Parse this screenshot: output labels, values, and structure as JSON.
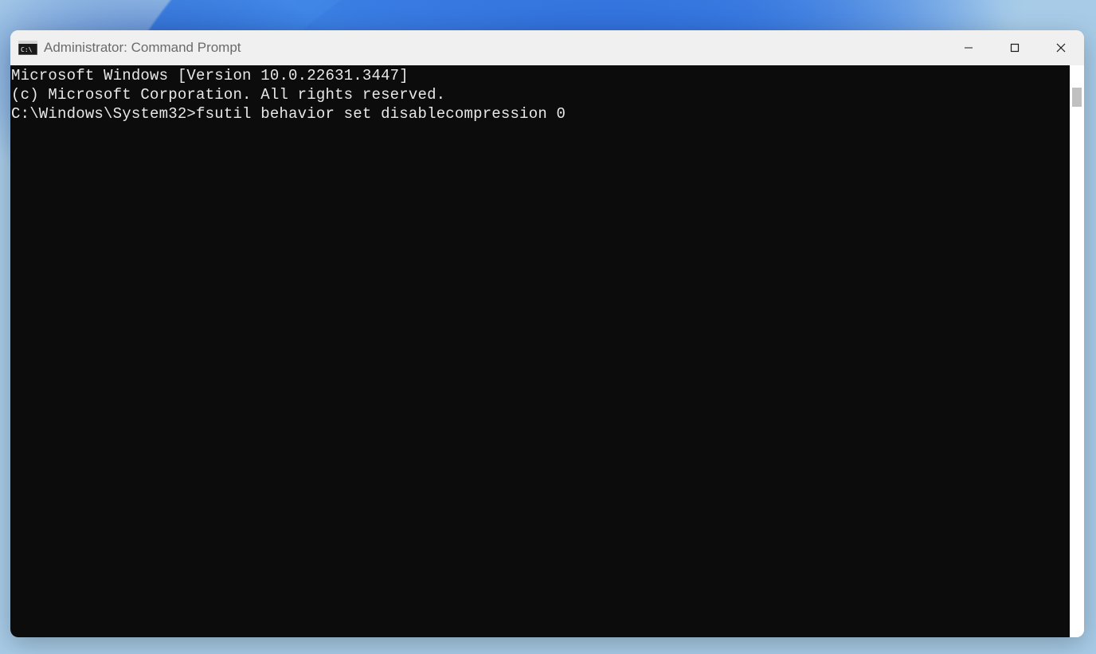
{
  "window": {
    "title": "Administrator: Command Prompt"
  },
  "terminal": {
    "line1": "Microsoft Windows [Version 10.0.22631.3447]",
    "line2": "(c) Microsoft Corporation. All rights reserved.",
    "blank": "",
    "prompt": "C:\\Windows\\System32>",
    "command": "fsutil behavior set disablecompression 0"
  }
}
